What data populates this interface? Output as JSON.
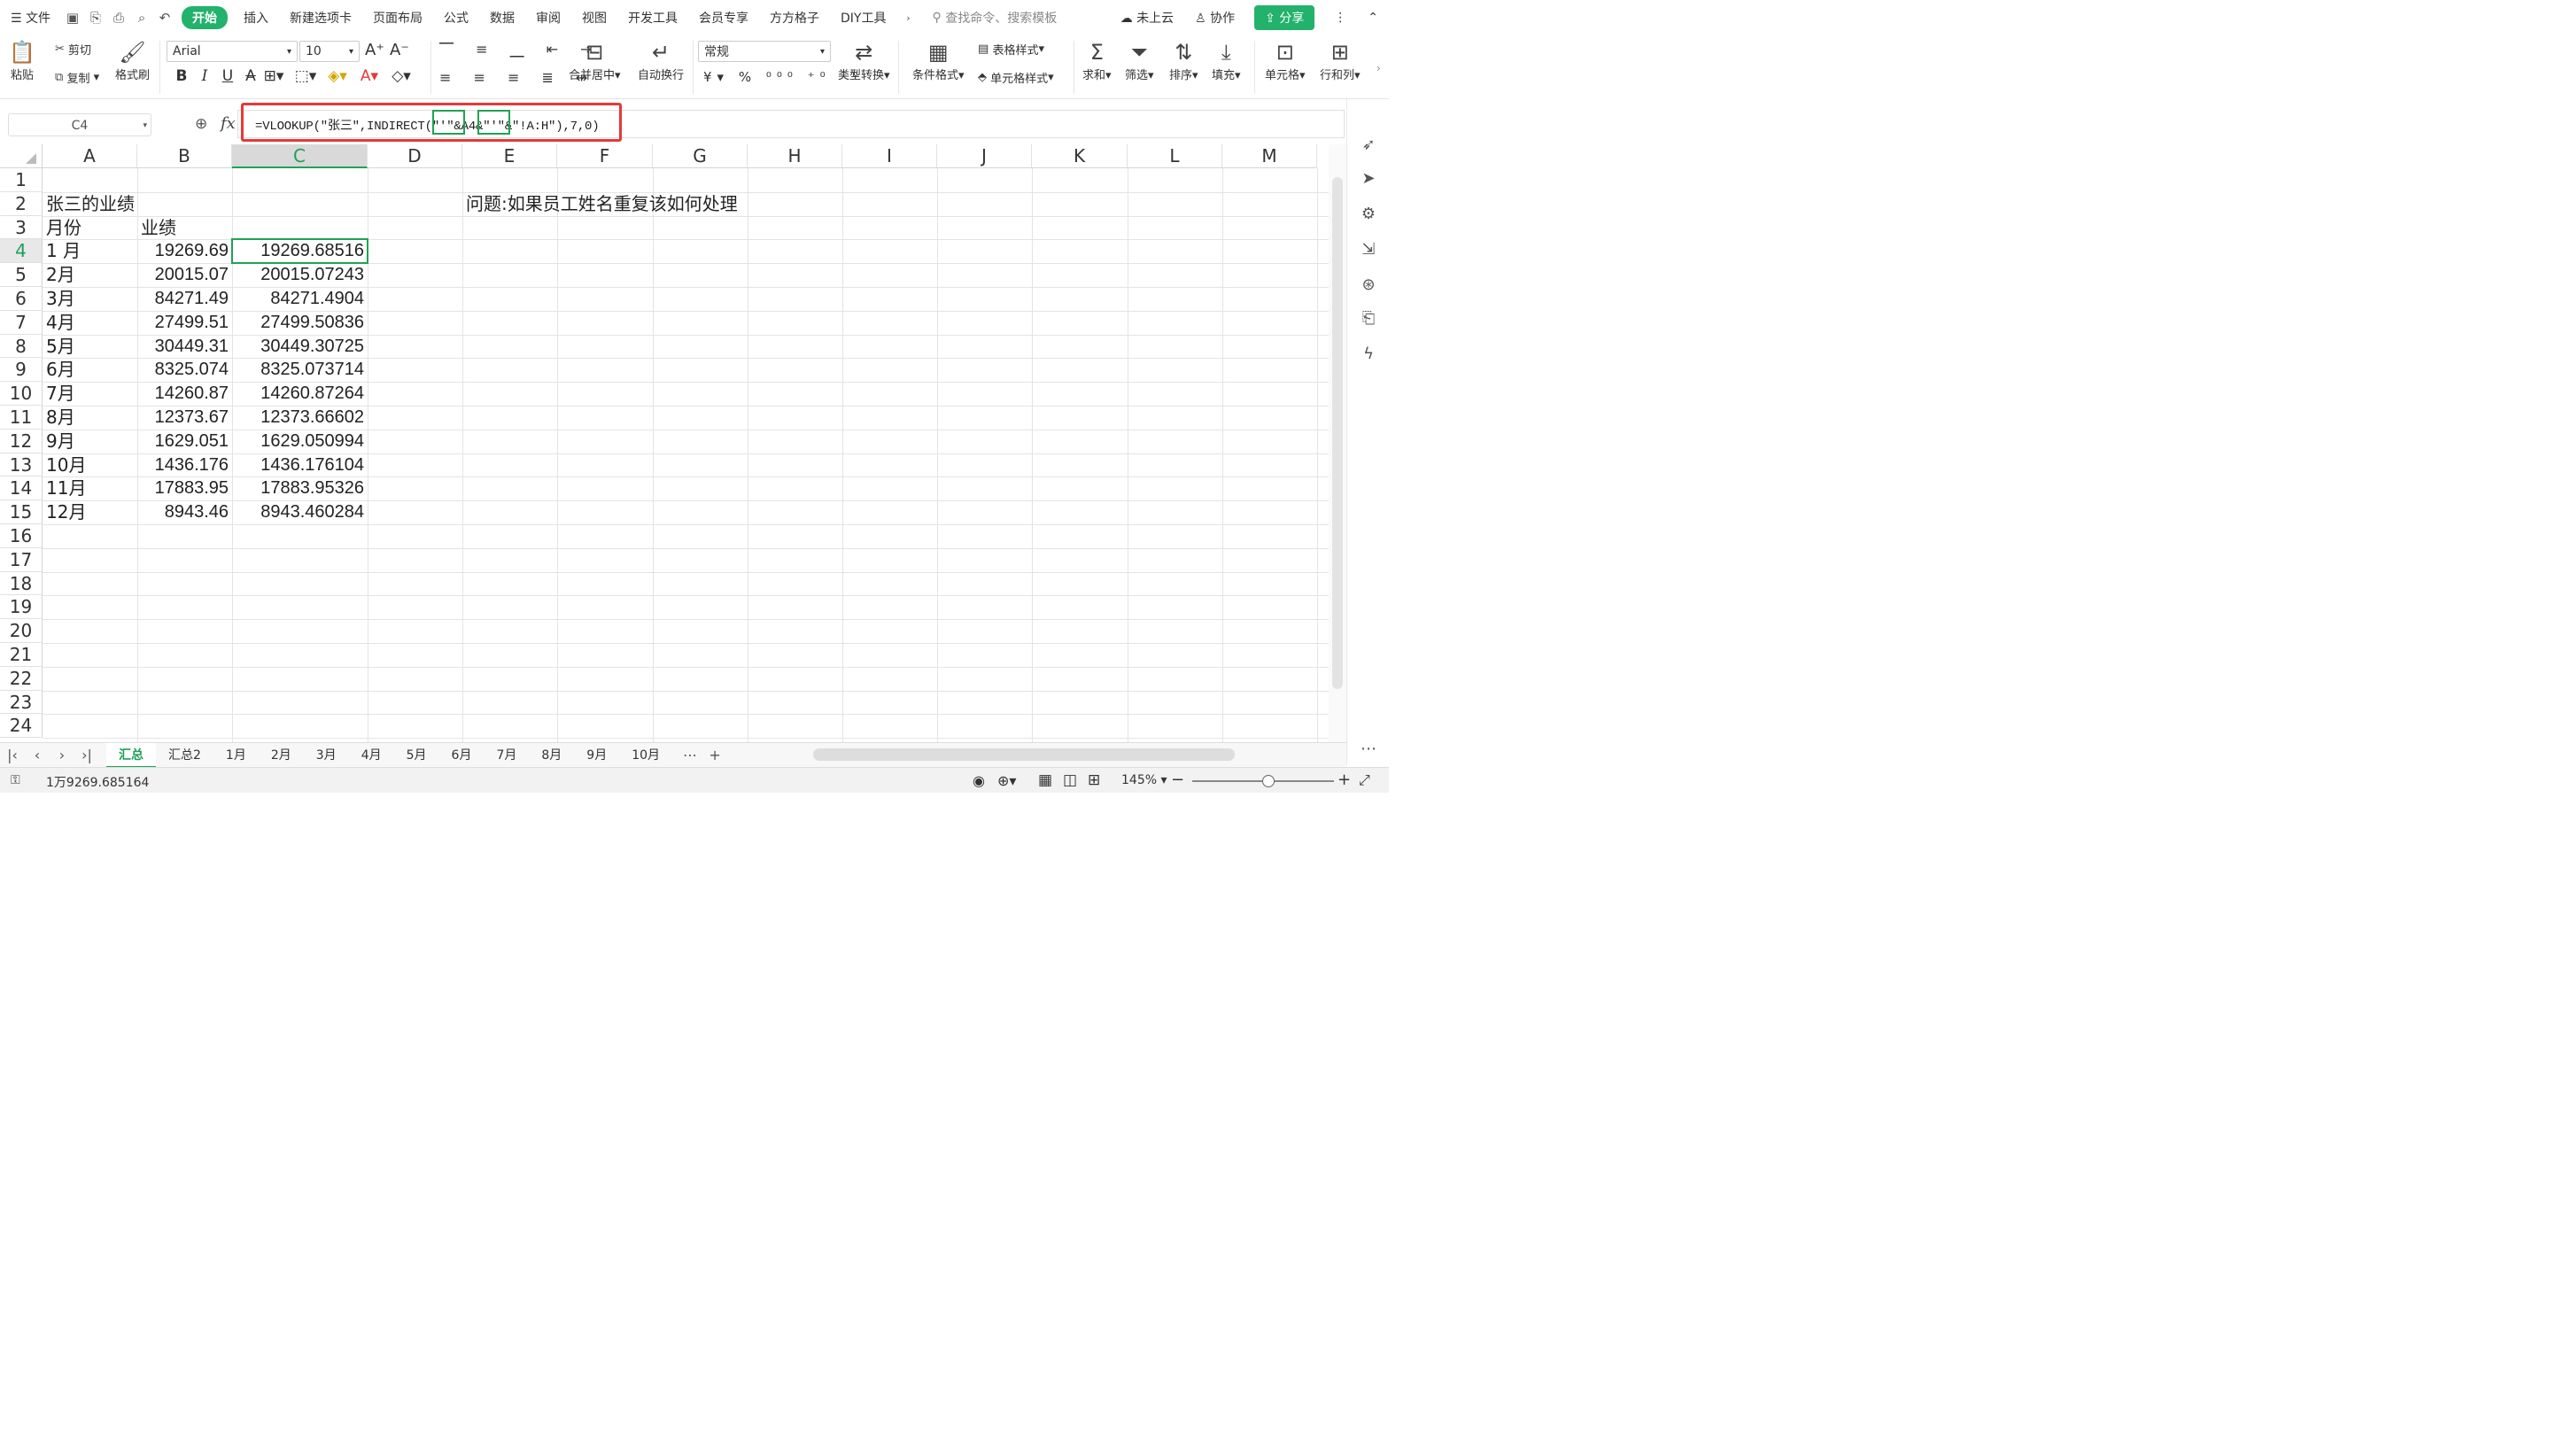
{
  "menubar": {
    "file_label": "文件",
    "tabs": [
      "开始",
      "插入",
      "新建选项卡",
      "页面布局",
      "公式",
      "数据",
      "审阅",
      "视图",
      "开发工具",
      "会员专享",
      "方方格子",
      "DIY工具"
    ],
    "active_tab": "开始",
    "search_placeholder": "查找命令、搜索模板",
    "cloud_label": "未上云",
    "collab_label": "协作",
    "share_label": "分享"
  },
  "ribbon": {
    "paste_label": "粘贴",
    "cut_label": "剪切",
    "copy_label": "复制",
    "format_painter_label": "格式刷",
    "font_name": "Arial",
    "font_size": "10",
    "merge_center_label": "合并居中",
    "wrap_text_label": "自动换行",
    "number_format": "常规",
    "type_convert_label": "类型转换",
    "cond_format_label": "条件格式",
    "table_style_label": "表格样式",
    "cell_style_label": "单元格样式",
    "sum_label": "求和",
    "filter_label": "筛选",
    "sort_label": "排序",
    "fill_label": "填充",
    "cell_label": "单元格",
    "rowcol_label": "行和列"
  },
  "formula_bar": {
    "name_box": "C4",
    "fx": "fx",
    "formula": "=VLOOKUP(\"张三\",INDIRECT(\"'\"&A4&\"'\"&\"!A:H\"),7,0)"
  },
  "columns": [
    "A",
    "B",
    "C",
    "D",
    "E",
    "F",
    "G",
    "H",
    "I",
    "J",
    "K",
    "L",
    "M"
  ],
  "selected_column": "C",
  "rows": [
    "1",
    "2",
    "3",
    "4",
    "5",
    "6",
    "7",
    "8",
    "9",
    "10",
    "11",
    "12",
    "13",
    "14",
    "15",
    "16",
    "17",
    "18",
    "19",
    "20",
    "21",
    "22",
    "23",
    "24"
  ],
  "selected_row": "4",
  "sheet": {
    "title": "张三的业绩",
    "question": "问题:如果员工姓名重复该如何处理",
    "header_month": "月份",
    "header_perf": "业绩",
    "data": [
      {
        "month": "1 月",
        "b": "19269.69",
        "c": "19269.68516"
      },
      {
        "month": "2月",
        "b": "20015.07",
        "c": "20015.07243"
      },
      {
        "month": "3月",
        "b": "84271.49",
        "c": "84271.4904"
      },
      {
        "month": "4月",
        "b": "27499.51",
        "c": "27499.50836"
      },
      {
        "month": "5月",
        "b": "30449.31",
        "c": "30449.30725"
      },
      {
        "month": "6月",
        "b": "8325.074",
        "c": "8325.073714"
      },
      {
        "month": "7月",
        "b": "14260.87",
        "c": "14260.87264"
      },
      {
        "month": "8月",
        "b": "12373.67",
        "c": "12373.66602"
      },
      {
        "month": "9月",
        "b": "1629.051",
        "c": "1629.050994"
      },
      {
        "month": "10月",
        "b": "1436.176",
        "c": "1436.176104"
      },
      {
        "month": "11月",
        "b": "17883.95",
        "c": "17883.95326"
      },
      {
        "month": "12月",
        "b": "8943.46",
        "c": "8943.460284"
      }
    ]
  },
  "sheet_tabs": [
    "汇总",
    "汇总2",
    "1月",
    "2月",
    "3月",
    "4月",
    "5月",
    "6月",
    "7月",
    "8月",
    "9月",
    "10月"
  ],
  "active_sheet": "汇总",
  "status": {
    "value": "1万9269.685164",
    "zoom": "145%"
  },
  "colors": {
    "accent": "#1fa354",
    "highlight_red": "#e53935"
  }
}
